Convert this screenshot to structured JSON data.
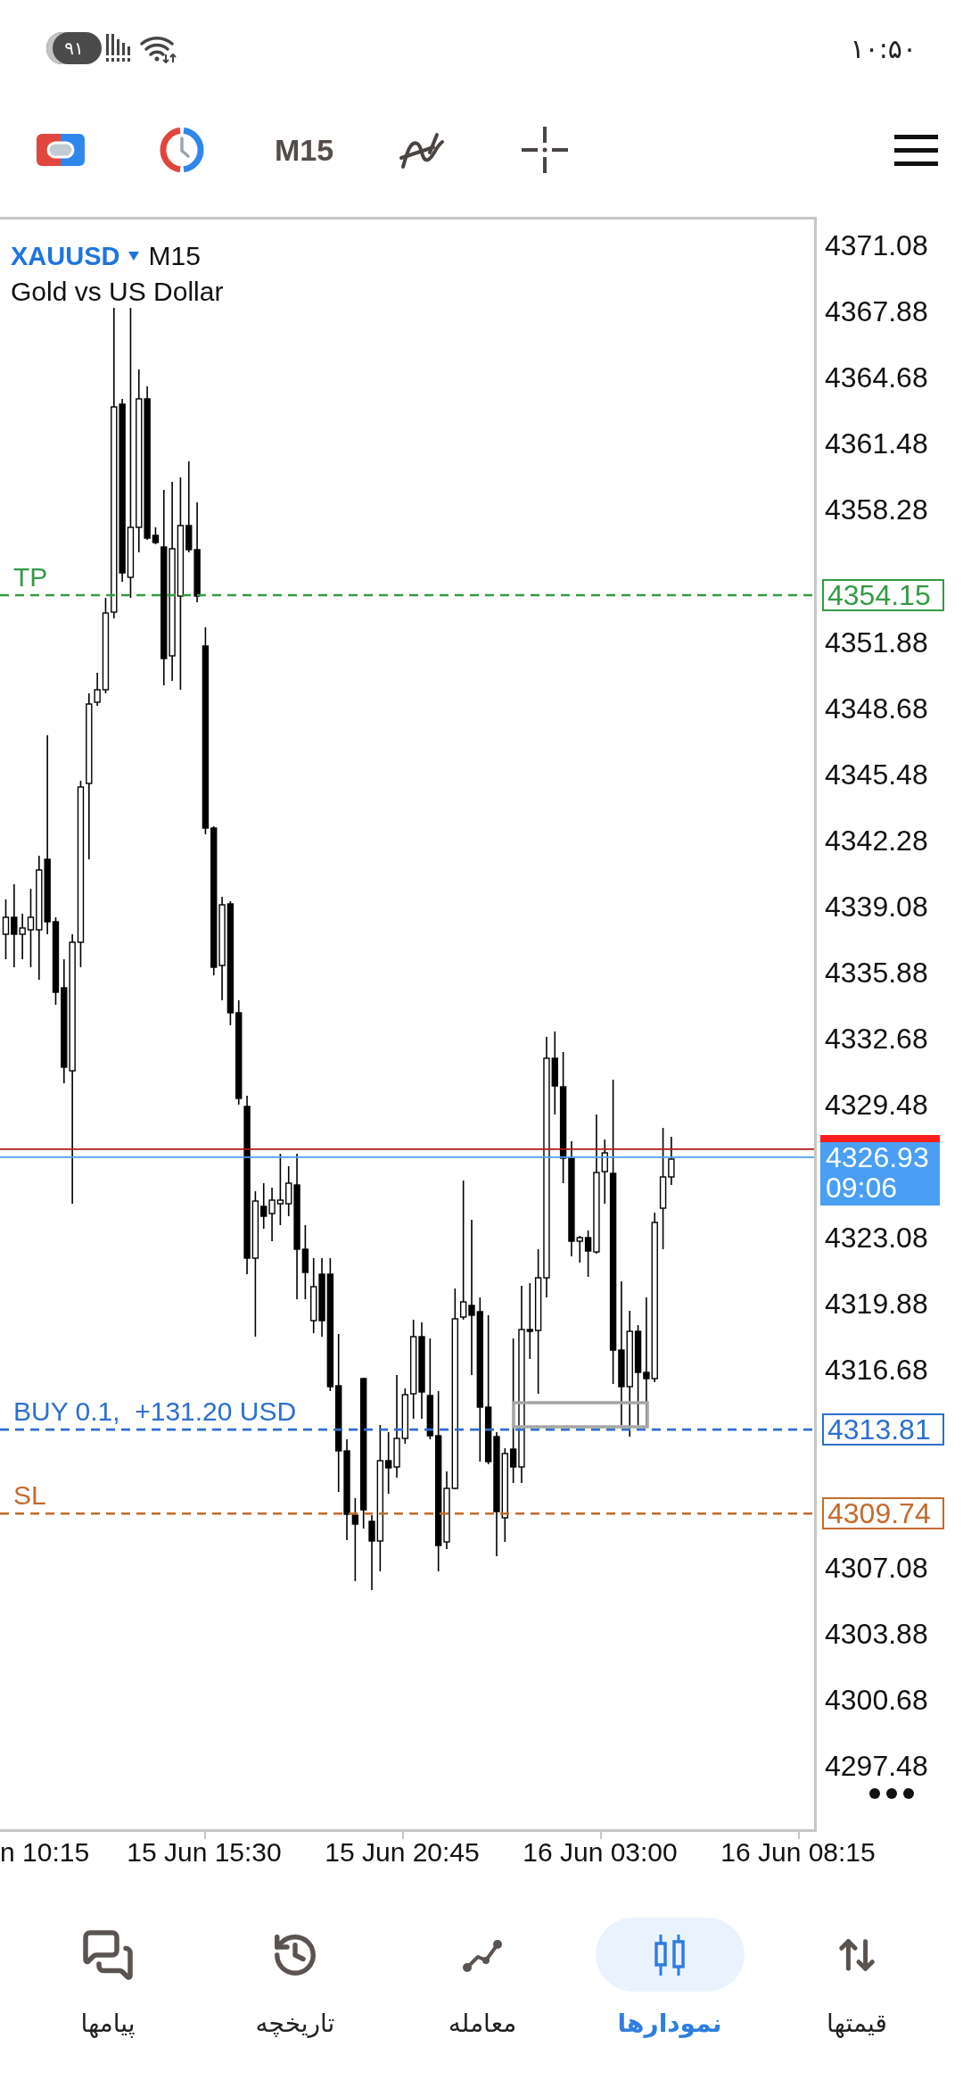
{
  "status_bar": {
    "battery": "۹۱",
    "time": "۱۰:۵۰"
  },
  "toolbar": {
    "timeframe": "M15"
  },
  "chart": {
    "symbol": "XAUUSD",
    "timeframe": "M15",
    "description": "Gold vs US Dollar",
    "price_axis": [
      "4371.08",
      "4367.88",
      "4364.68",
      "4361.48",
      "4358.28",
      "4351.88",
      "4348.68",
      "4345.48",
      "4342.28",
      "4339.08",
      "4335.88",
      "4332.68",
      "4329.48",
      "4323.08",
      "4319.88",
      "4316.68",
      "4307.08",
      "4303.88",
      "4300.68",
      "4297.48"
    ],
    "time_axis": [
      "n 10:15",
      "15 Jun 15:30",
      "15 Jun 20:45",
      "16 Jun 03:00",
      "16 Jun 08:15"
    ],
    "levels": [
      {
        "kind": "tp",
        "label": "TP",
        "price": "4354.15",
        "color": "#349a44"
      },
      {
        "kind": "position",
        "label": "BUY 0.1,  +131.20 USD",
        "price": "4313.81",
        "color": "#2e6fd0"
      },
      {
        "kind": "sl",
        "label": "SL",
        "price": "4309.74",
        "color": "#c46a2c"
      }
    ],
    "current_price": {
      "price": "4326.93",
      "countdown": "09:06"
    }
  },
  "nav": [
    {
      "label": "قیمتها",
      "selected": false
    },
    {
      "label": "نمودارها",
      "selected": true
    },
    {
      "label": "معامله",
      "selected": false
    },
    {
      "label": "تاریخچه",
      "selected": false
    },
    {
      "label": "پیامها",
      "selected": false
    }
  ]
}
